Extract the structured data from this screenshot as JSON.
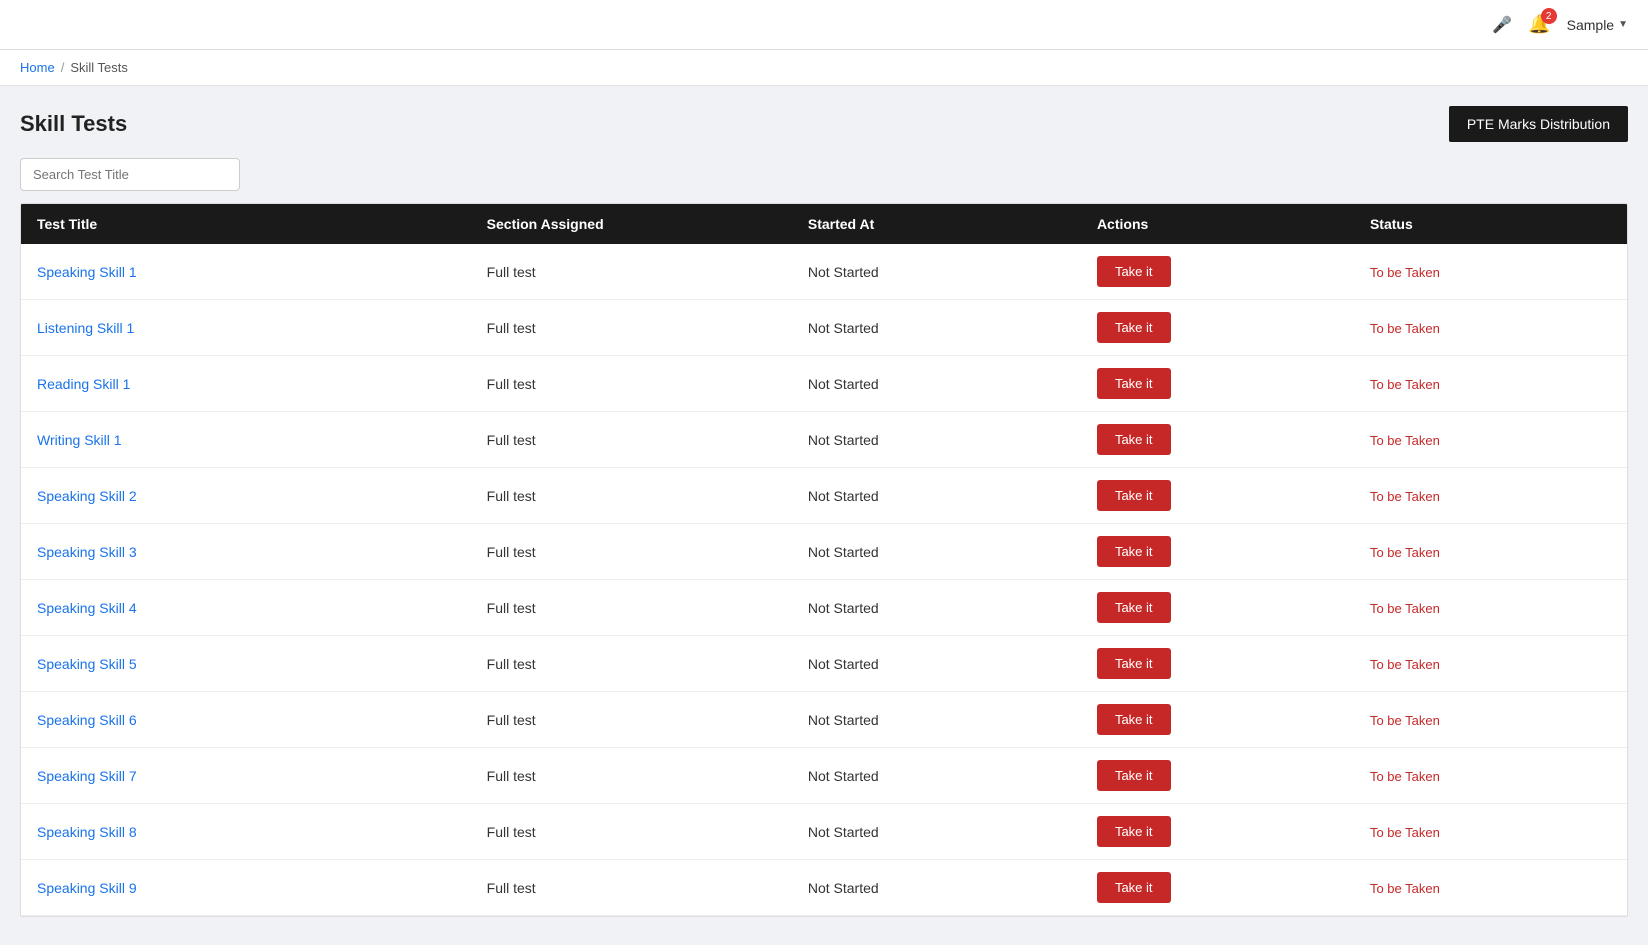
{
  "navbar": {
    "mic_label": "🎤",
    "notification_count": "2",
    "user_name": "Sample",
    "chevron": "▼"
  },
  "breadcrumb": {
    "home": "Home",
    "separator": "/",
    "current": "Skill Tests"
  },
  "page": {
    "title": "Skill Tests",
    "pte_button_label": "PTE Marks Distribution"
  },
  "search": {
    "placeholder": "Search Test Title"
  },
  "table": {
    "headers": [
      "Test Title",
      "Section Assigned",
      "Started At",
      "Actions",
      "Status"
    ],
    "rows": [
      {
        "title": "Speaking Skill 1",
        "section": "Full test",
        "started": "Not Started",
        "action": "Take it",
        "status": "To be Taken"
      },
      {
        "title": "Listening Skill 1",
        "section": "Full test",
        "started": "Not Started",
        "action": "Take it",
        "status": "To be Taken"
      },
      {
        "title": "Reading Skill 1",
        "section": "Full test",
        "started": "Not Started",
        "action": "Take it",
        "status": "To be Taken"
      },
      {
        "title": "Writing Skill 1",
        "section": "Full test",
        "started": "Not Started",
        "action": "Take it",
        "status": "To be Taken"
      },
      {
        "title": "Speaking Skill 2",
        "section": "Full test",
        "started": "Not Started",
        "action": "Take it",
        "status": "To be Taken"
      },
      {
        "title": "Speaking Skill 3",
        "section": "Full test",
        "started": "Not Started",
        "action": "Take it",
        "status": "To be Taken"
      },
      {
        "title": "Speaking Skill 4",
        "section": "Full test",
        "started": "Not Started",
        "action": "Take it",
        "status": "To be Taken"
      },
      {
        "title": "Speaking Skill 5",
        "section": "Full test",
        "started": "Not Started",
        "action": "Take it",
        "status": "To be Taken"
      },
      {
        "title": "Speaking Skill 6",
        "section": "Full test",
        "started": "Not Started",
        "action": "Take it",
        "status": "To be Taken"
      },
      {
        "title": "Speaking Skill 7",
        "section": "Full test",
        "started": "Not Started",
        "action": "Take it",
        "status": "To be Taken"
      },
      {
        "title": "Speaking Skill 8",
        "section": "Full test",
        "started": "Not Started",
        "action": "Take it",
        "status": "To be Taken"
      },
      {
        "title": "Speaking Skill 9",
        "section": "Full test",
        "started": "Not Started",
        "action": "Take it",
        "status": "To be Taken"
      }
    ]
  }
}
